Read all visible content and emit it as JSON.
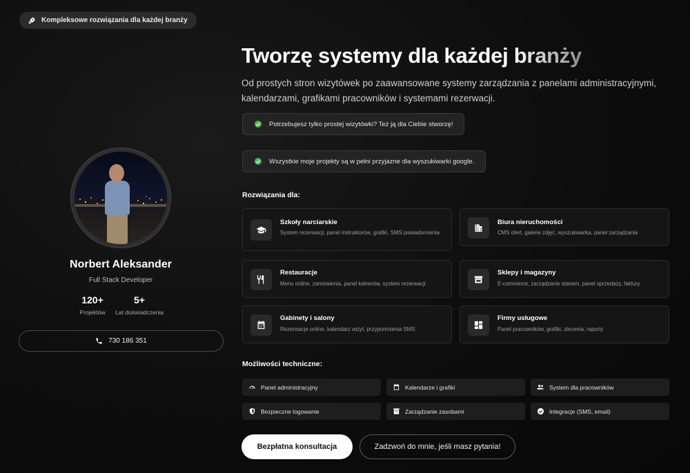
{
  "badge": {
    "icon": "rocket-icon",
    "label": "Kompleksowe rozwiązania dla każdej branży"
  },
  "profile": {
    "name": "Norbert Aleksander",
    "role": "Full Stack Developer",
    "stats": [
      {
        "value": "120+",
        "label": "Projektów"
      },
      {
        "value": "5+",
        "label": "Lat doświadczenia"
      }
    ],
    "phone": {
      "icon": "phone-icon",
      "label": "730 186 351"
    }
  },
  "hero": {
    "title_main": "Tworzę systemy dla każdej ",
    "title_fade": "branży",
    "lead": "Od prostych stron wizytówek po zaawansowane systemy zarządzania z panelami administracyjnymi, kalendarzami, grafikami pracowników i systemami rezerwacji.",
    "checks": [
      "Potrzebujesz tylko prostej wizytówki? Też ją dla Ciebie stworzę!",
      "Wszystkie moje projekty są w pełni przyjazne dla wyszukiwarki google."
    ]
  },
  "solutions": {
    "label": "Rozwiązania dla:",
    "items": [
      {
        "icon": "graduation-cap-icon",
        "title": "Szkoły narciarskie",
        "desc": "System rezerwacji, panel instruktorów, grafiki, SMS powiadomienia"
      },
      {
        "icon": "building-icon",
        "title": "Biura nieruchomości",
        "desc": "CMS ofert, galerie zdjęć, wyszukiwarka, panel zarządzania"
      },
      {
        "icon": "cutlery-icon",
        "title": "Restauracje",
        "desc": "Menu online, zamówienia, panel kelnerów, system rezerwacji"
      },
      {
        "icon": "store-icon",
        "title": "Sklepy i magazyny",
        "desc": "E-commerce, zarządzanie stanem, panel sprzedaży, faktury"
      },
      {
        "icon": "calendar-icon",
        "title": "Gabinety i salony",
        "desc": "Rezerwacje online, kalendarz wizyt, przypomnienia SMS"
      },
      {
        "icon": "dashboard-icon",
        "title": "Firmy usługowe",
        "desc": "Panel pracowników, grafiki, zlecenia, raporty"
      }
    ]
  },
  "tech": {
    "label": "Możliwości techniczne:",
    "items": [
      {
        "icon": "gauge-icon",
        "label": "Panel administracyjny"
      },
      {
        "icon": "calendar-icon",
        "label": "Kalendarze i grafiki"
      },
      {
        "icon": "people-icon",
        "label": "System dla pracowników"
      },
      {
        "icon": "shield-icon",
        "label": "Bezpieczne logowanie"
      },
      {
        "icon": "archive-icon",
        "label": "Zarządzanie zasobami"
      },
      {
        "icon": "check-circle-icon",
        "label": "Integracje (SMS, email)"
      }
    ]
  },
  "cta": {
    "primary": "Bezpłatna konsultacja",
    "secondary": "Zadzwoń do mnie, jeśli masz pytania!"
  }
}
